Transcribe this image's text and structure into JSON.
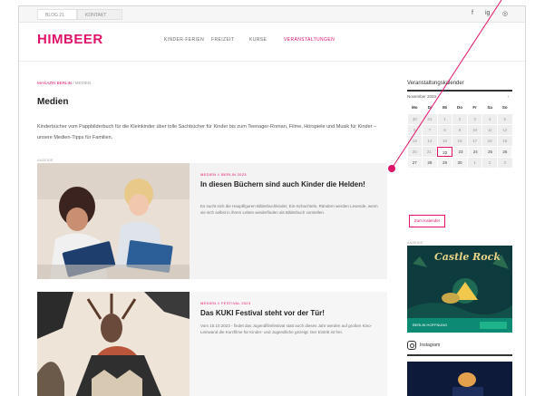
{
  "topbar": {
    "tab_1": "BLOG 21",
    "tab_2": "KONTAKT",
    "social": [
      "f",
      "ig",
      "◎"
    ]
  },
  "header": {
    "logo": "HIMBEER",
    "nav": [
      {
        "label": "KINDER-FERIEN"
      },
      {
        "label": "FREIZEIT"
      },
      {
        "label": "KURSE"
      },
      {
        "label": "VERANSTALTUNGEN",
        "active": true
      }
    ]
  },
  "breadcrumb": {
    "parent": "MAGAZIN BERLIN",
    "separator": " / ",
    "current": "MEDIEN"
  },
  "page": {
    "title": "Medien",
    "intro": "Kinderbücher vom Pappbilderbuch für die Kleinkinder über tolle Sachbücher für Kinder bis zum Teenager-Roman, Filme, Hörspiele und Musik für Kinder – unsere Medien-Tipps für Familien.",
    "small_label": "ANZEIGE"
  },
  "articles": [
    {
      "meta": "MEDIEN // BERLIN 2023",
      "headline": "In diesen Büchern sind auch Kinder die Helden!",
      "text": "Es sucht sich die Hauptfiguren Bilderbuchkinder, Ein-Schachteln, Rändern werden Lesende, wenn sie sich selbst in ihrem Leben wiederfinden als Bilderbuch vorstellen."
    },
    {
      "meta": "MEDIEN // FESTIVAL 2023",
      "headline": "Das KUKI Festival steht vor der Tür!",
      "text": "Vom 15.10.2023 - findet das Jugendfilmfestival statt auch dieses Jahr werden auf großen Kino-Leinwand die Kurzfilme für Kinder- und Jugendliche gezeigt. Der Eintritt ist frei."
    }
  ],
  "sidebar": {
    "calendar_title": "Veranstaltungskalender",
    "month": "November 2023",
    "arrow": "›",
    "weekdays": [
      "Mo",
      "Di",
      "Mi",
      "Do",
      "Fr",
      "Sa",
      "So"
    ],
    "weeks": [
      [
        "30",
        "31",
        "1",
        "2",
        "3",
        "4",
        "5"
      ],
      [
        "6",
        "7",
        "8",
        "9",
        "10",
        "11",
        "12"
      ],
      [
        "13",
        "14",
        "15",
        "16",
        "17",
        "18",
        "19"
      ],
      [
        "20",
        "21",
        "22",
        "23",
        "24",
        "25",
        "26"
      ],
      [
        "27",
        "28",
        "29",
        "30",
        "1",
        "2",
        "3"
      ]
    ],
    "today": "22",
    "calendar_button": "Zum Kalender",
    "ad_label": "ANZEIGE",
    "ad_title": "Castle Rock",
    "ad_footer": "BERLIN HOFFNUNG",
    "instagram_label": "Instagram"
  },
  "colors": {
    "accent": "#e0136a",
    "ad_green": "#0c8a73"
  }
}
